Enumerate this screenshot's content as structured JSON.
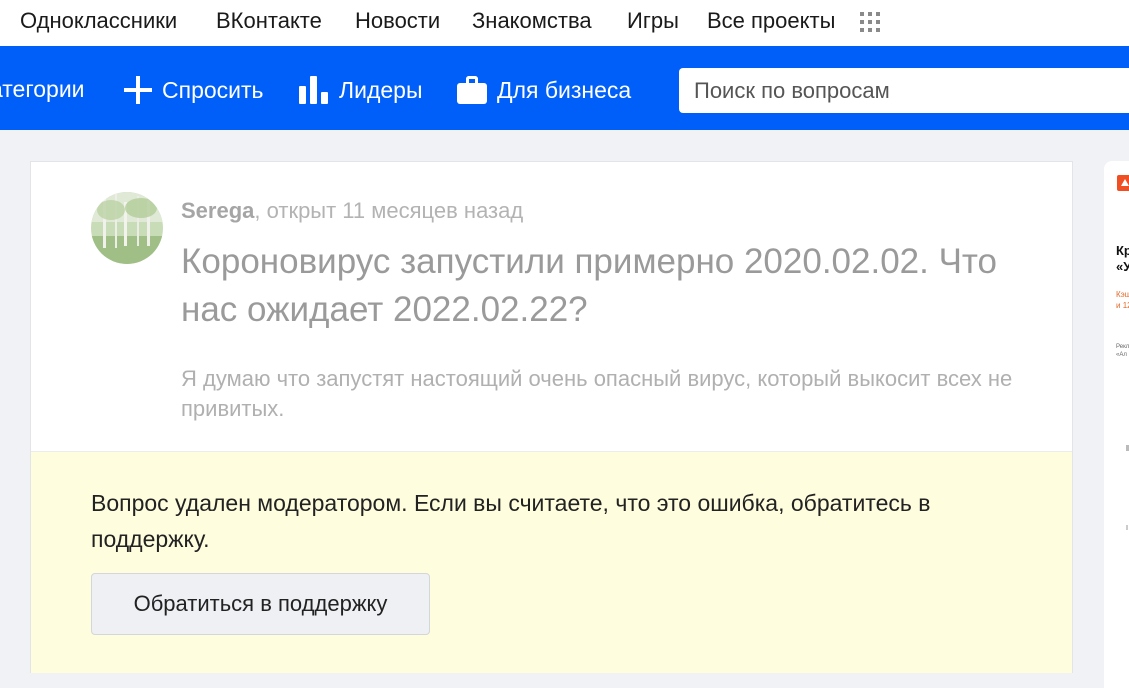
{
  "top_projects": [
    "Одноклассники",
    "ВКонтакте",
    "Новости",
    "Знакомства",
    "Игры",
    "Все проекты"
  ],
  "nav": {
    "categories": "атегории",
    "ask": "Спросить",
    "leaders": "Лидеры",
    "business": "Для бизнеса",
    "search_placeholder": "Поиск по вопросам"
  },
  "question": {
    "author": "Serega",
    "meta": ", открыт 11 месяцев назад",
    "title": "Короновирус запустили примерно 2020.02.02. Что нас ожидает 2022.02.22?",
    "text": "Я думаю что запустят настоящий очень опасный вирус, который выкосит всех не привитых."
  },
  "notice": {
    "text": "Вопрос удален модератором. Если вы считаете, что это ошибка, обратитесь в поддержку.",
    "button": "Обратиться в поддержку"
  },
  "ad": {
    "line1": "Кр",
    "line2": "«У",
    "line3": "Кэш",
    "line4": "и 12",
    "line5": "Рекл",
    "line6": "«Ал"
  },
  "colors": {
    "brand_blue": "#005ff9",
    "notice_bg": "#fefdde"
  }
}
